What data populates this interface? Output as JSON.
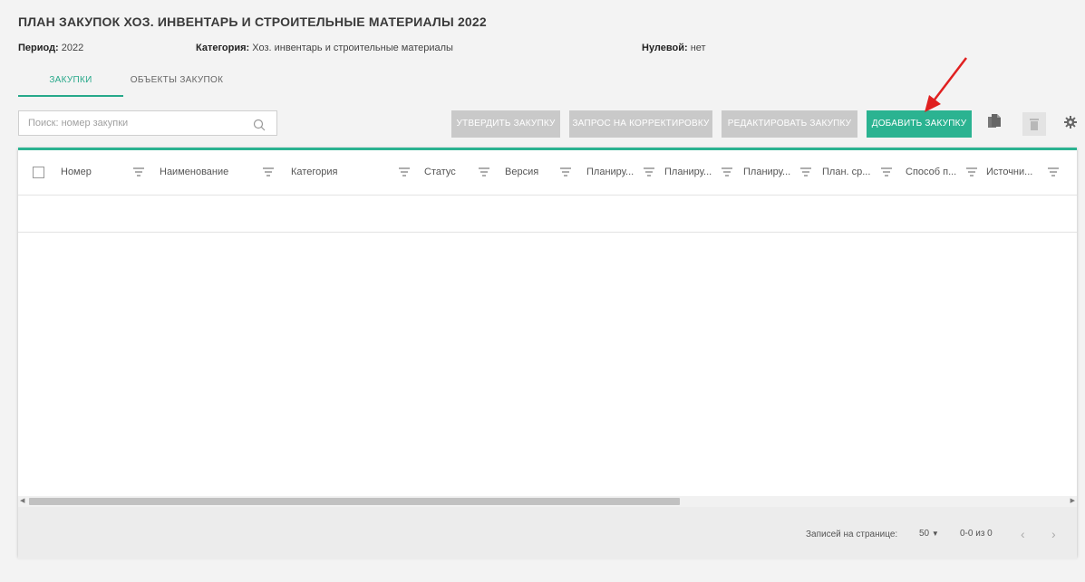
{
  "page": {
    "title": "ПЛАН ЗАКУПОК ХОЗ. ИНВЕНТАРЬ И СТРОИТЕЛЬНЫЕ МАТЕРИАЛЫ 2022"
  },
  "meta": {
    "period_label": "Период:",
    "period_value": "2022",
    "category_label": "Категория:",
    "category_value": "Хоз. инвентарь и строительные материалы",
    "zero_label": "Нулевой:",
    "zero_value": "нет"
  },
  "tabs": [
    {
      "label": "ЗАКУПКИ",
      "active": true
    },
    {
      "label": "ОБЪЕКТЫ ЗАКУПОК",
      "active": false
    }
  ],
  "search": {
    "placeholder": "Поиск: номер закупки",
    "value": ""
  },
  "toolbar": {
    "approve_label": "УТВЕРДИТЬ ЗАКУПКУ",
    "correction_label": "ЗАПРОС НА КОРРЕКТИРОВКУ",
    "edit_label": "РЕДАКТИРОВАТЬ ЗАКУПКУ",
    "add_label": "ДОБАВИТЬ ЗАКУПКУ",
    "copy_icon": "copy-icon",
    "delete_icon": "trash-icon",
    "settings_icon": "gear-icon"
  },
  "table": {
    "columns": [
      "Номер",
      "Наименование",
      "Категория",
      "Статус",
      "Версия",
      "Планиру...",
      "Планиру...",
      "Планиру...",
      "План. ср...",
      "Способ п...",
      "Источни..."
    ],
    "rows": []
  },
  "footer": {
    "per_page_label": "Записей на странице:",
    "per_page_value": "50",
    "range": "0-0 из 0"
  },
  "colors": {
    "accent": "#2bb391",
    "disabled_button": "#c9c9c9",
    "annotation_arrow": "#e02020"
  }
}
